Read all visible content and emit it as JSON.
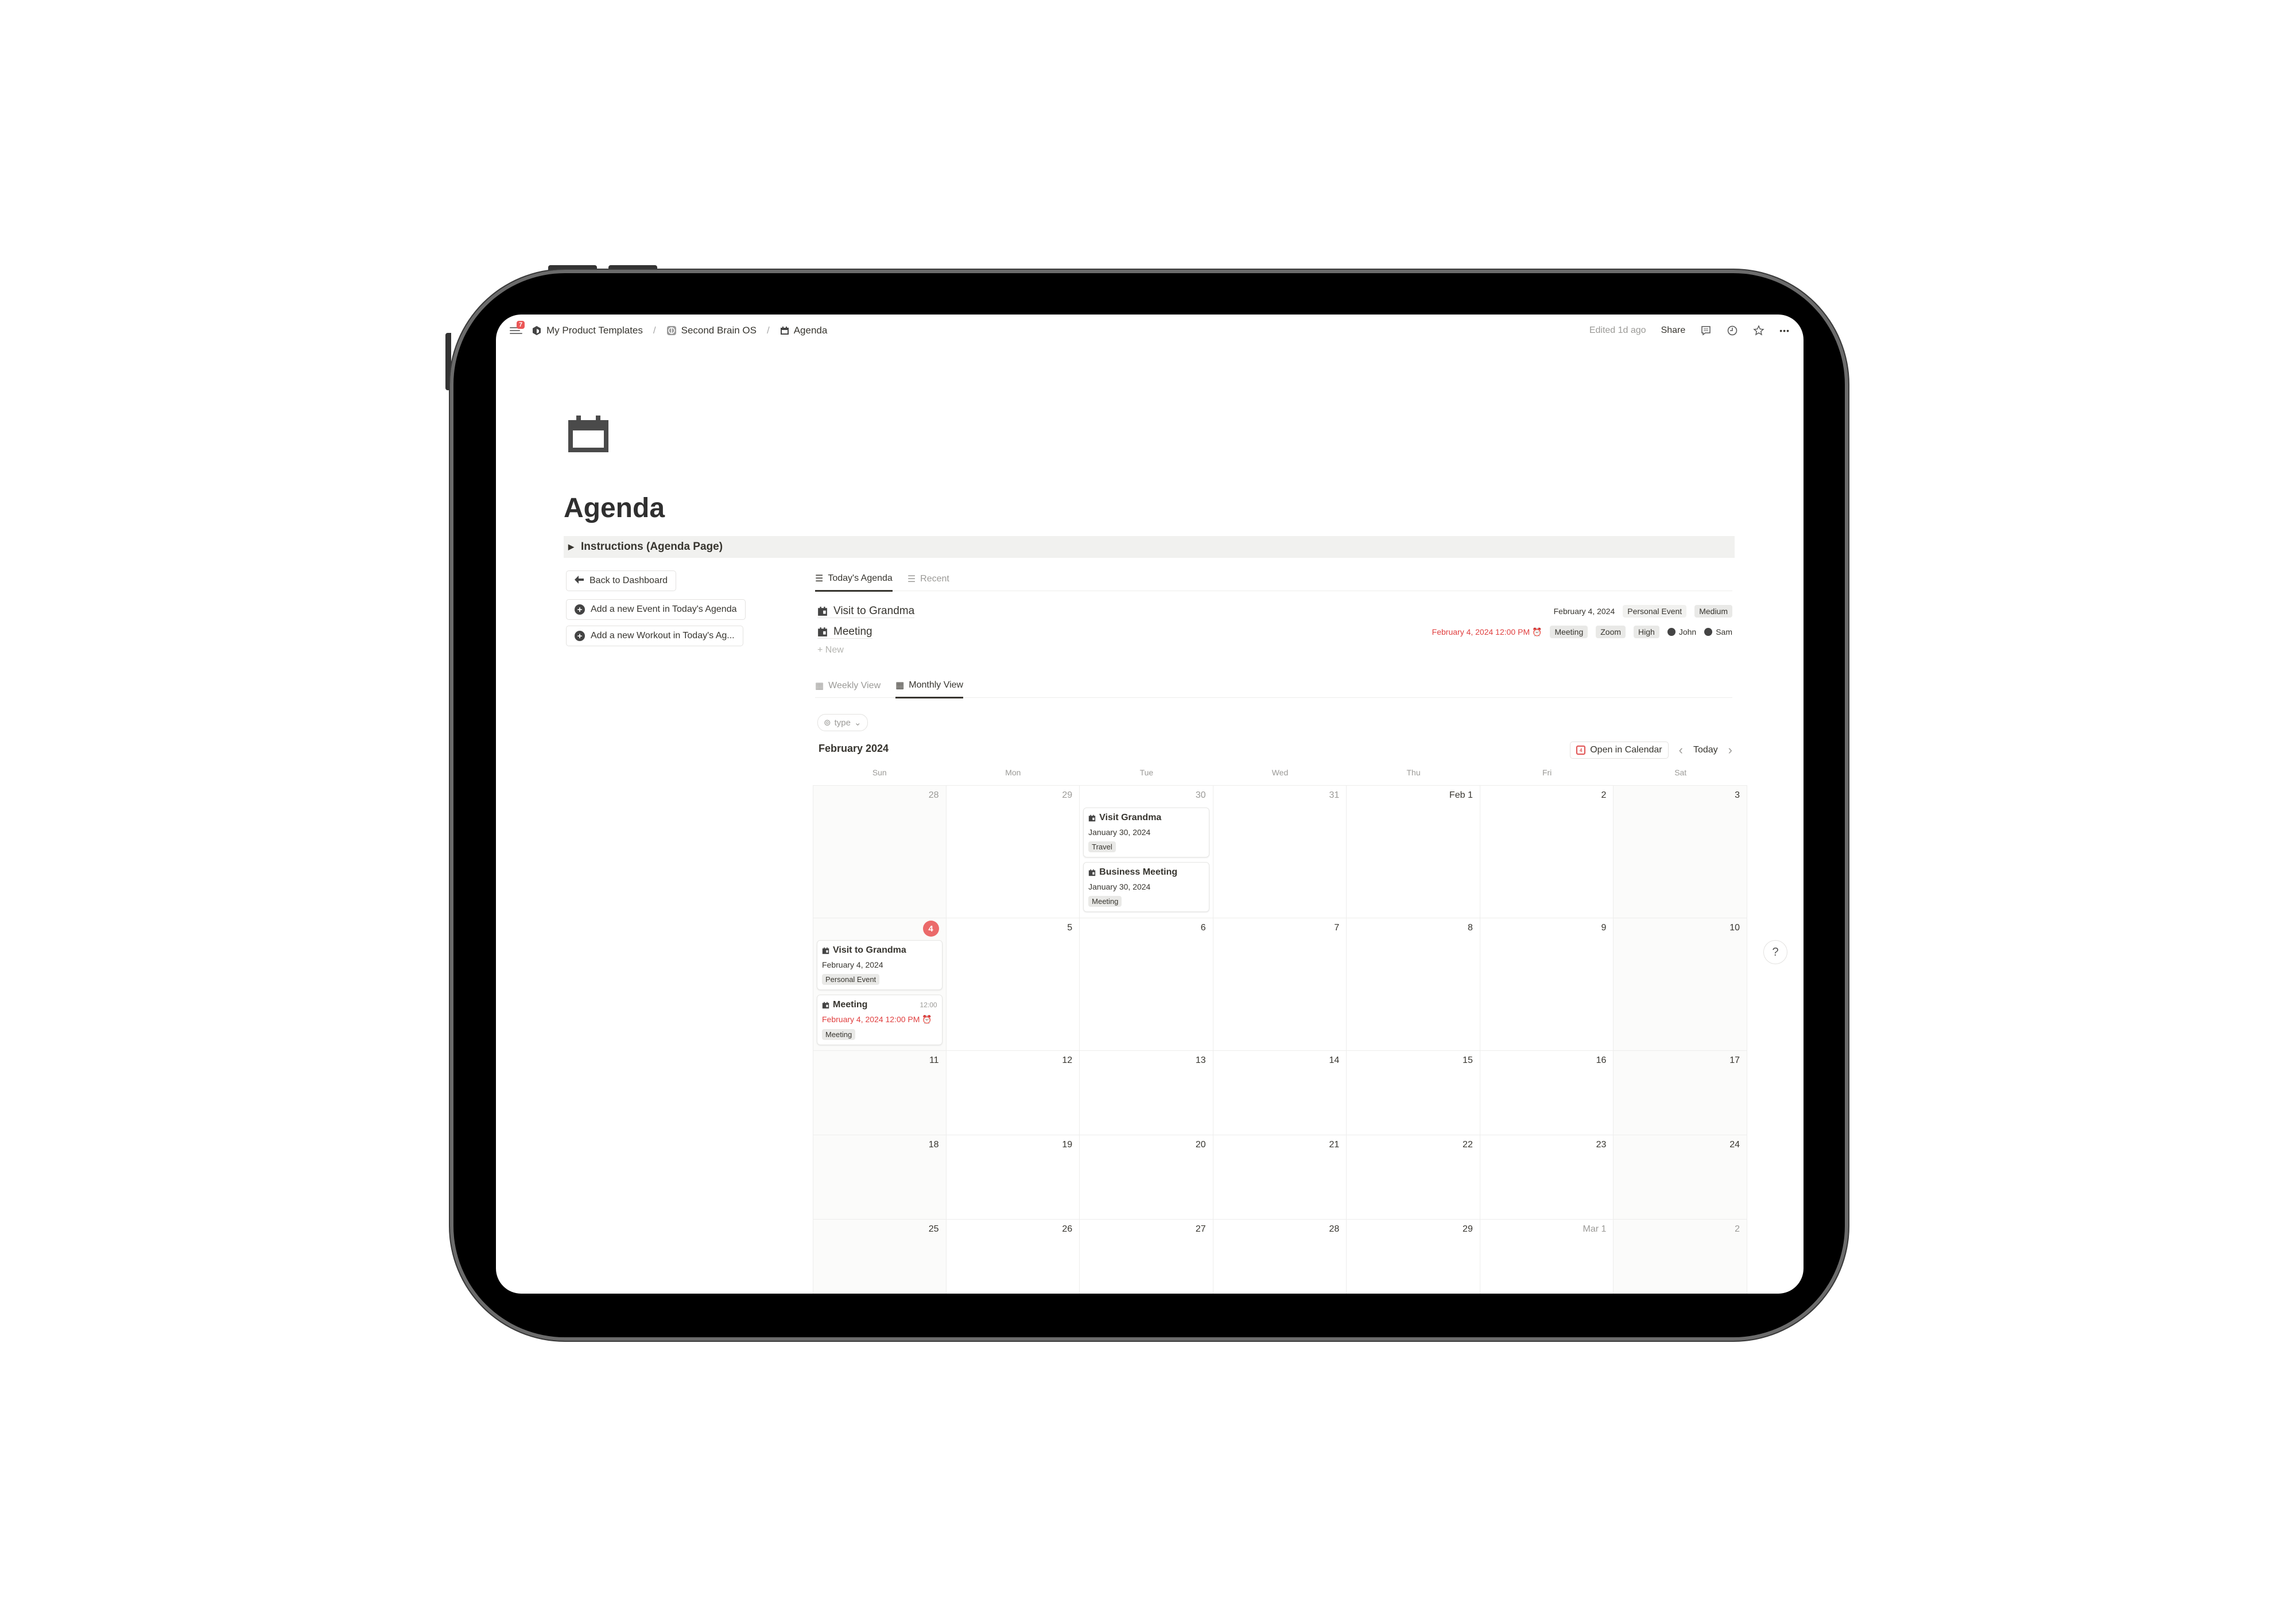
{
  "topbar": {
    "notification_count": "7",
    "breadcrumb": [
      {
        "label": "My Product Templates",
        "icon": "cube-icon"
      },
      {
        "label": "Second Brain OS",
        "icon": "brain-icon"
      },
      {
        "label": "Agenda",
        "icon": "calendar-icon"
      }
    ],
    "separator": "/",
    "edited": "Edited 1d ago",
    "share_label": "Share",
    "icons": [
      "comment-icon",
      "clock-icon",
      "star-icon",
      "more-icon"
    ],
    "more_glyph": "•••"
  },
  "page": {
    "icon": "calendar-icon",
    "title": "Agenda",
    "toggle_label": "Instructions (Agenda Page)",
    "toggle_glyph": "▶"
  },
  "left_buttons": [
    {
      "label": "Back to Dashboard",
      "icon": "arrow-left-icon",
      "glyph": "🡐"
    },
    {
      "label": "Add a new Event in Today's Agenda",
      "icon": "plus-circle-icon",
      "glyph": "+"
    },
    {
      "label": "Add a new Workout in Today's Ag...",
      "icon": "plus-circle-icon",
      "glyph": "+"
    }
  ],
  "agenda_tabs": [
    {
      "label": "Today's Agenda",
      "active": true
    },
    {
      "label": "Recent",
      "active": false
    }
  ],
  "agenda_rows": [
    {
      "title": "Visit to Grandma",
      "date": "February 4, 2024",
      "tags": [
        "Personal Event",
        "Medium"
      ]
    },
    {
      "title": "Meeting",
      "date": "February 4, 2024 12:00 PM",
      "date_red": true,
      "tags": [
        "Meeting",
        "Zoom",
        "High"
      ],
      "people": [
        "John",
        "Sam"
      ]
    }
  ],
  "new_label": "+ New",
  "view_tabs": [
    {
      "label": "Weekly View",
      "active": false
    },
    {
      "label": "Monthly View",
      "active": true
    }
  ],
  "filter": {
    "label": "type",
    "chevron": "⌄"
  },
  "calendar": {
    "month_label": "February 2024",
    "open_in_calendar": "Open in Calendar",
    "open_cal_icon_text": "4",
    "today_label": "Today",
    "prev": "‹",
    "next": "›",
    "weekdays": [
      "Sun",
      "Mon",
      "Tue",
      "Wed",
      "Thu",
      "Fri",
      "Sat"
    ],
    "weeks": [
      [
        {
          "n": "28",
          "out": true
        },
        {
          "n": "29",
          "out": true
        },
        {
          "n": "30",
          "out": true,
          "events": [
            {
              "title": "Visit Grandma",
              "date": "January 30, 2024",
              "tag": "Travel"
            },
            {
              "title": "Business Meeting",
              "date": "January 30, 2024",
              "tag": "Meeting"
            }
          ]
        },
        {
          "n": "31",
          "out": true
        },
        {
          "n": "Feb 1"
        },
        {
          "n": "2"
        },
        {
          "n": "3"
        }
      ],
      [
        {
          "n": "4",
          "today": true,
          "events": [
            {
              "title": "Visit to Grandma",
              "date": "February 4, 2024",
              "tag": "Personal Event"
            },
            {
              "title": "Meeting",
              "time": "12:00",
              "date": "February 4, 2024 12:00 PM",
              "date_red": true,
              "tag": "Meeting"
            }
          ]
        },
        {
          "n": "5"
        },
        {
          "n": "6"
        },
        {
          "n": "7"
        },
        {
          "n": "8"
        },
        {
          "n": "9"
        },
        {
          "n": "10"
        }
      ],
      [
        {
          "n": "11"
        },
        {
          "n": "12"
        },
        {
          "n": "13"
        },
        {
          "n": "14"
        },
        {
          "n": "15"
        },
        {
          "n": "16"
        },
        {
          "n": "17"
        }
      ],
      [
        {
          "n": "18"
        },
        {
          "n": "19"
        },
        {
          "n": "20"
        },
        {
          "n": "21"
        },
        {
          "n": "22"
        },
        {
          "n": "23"
        },
        {
          "n": "24"
        }
      ],
      [
        {
          "n": "25"
        },
        {
          "n": "26"
        },
        {
          "n": "27"
        },
        {
          "n": "28"
        },
        {
          "n": "29"
        },
        {
          "n": "Mar 1",
          "out": true
        },
        {
          "n": "2",
          "out": true
        }
      ]
    ]
  },
  "help_label": "?",
  "colors": {
    "accent_red": "#e03e3e",
    "today_badge": "#eb6a6a",
    "tag_bg": "#e9e9e7"
  }
}
